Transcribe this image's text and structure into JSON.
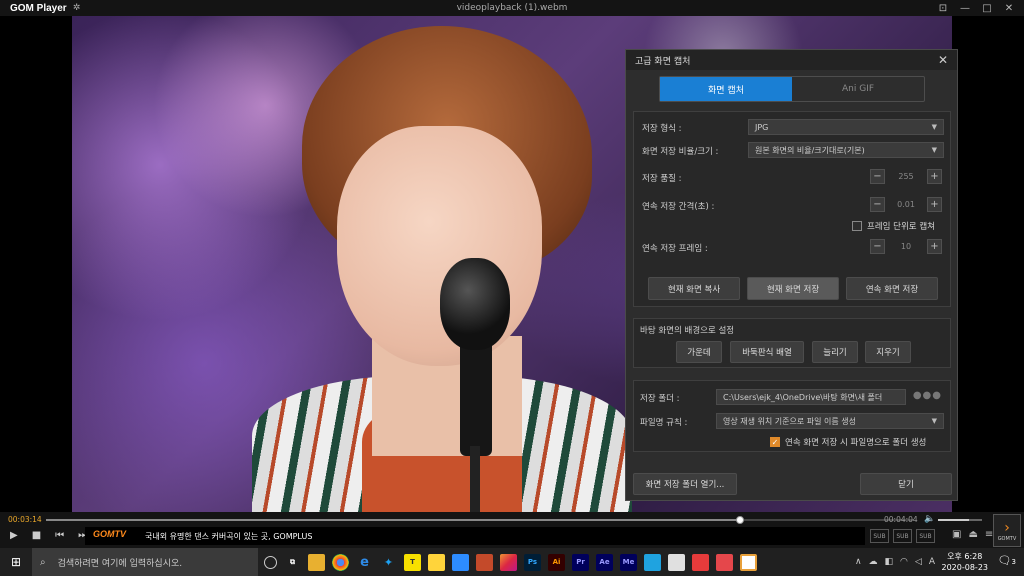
{
  "window": {
    "app_name": "GOM Player",
    "file_title": "videoplayback (1).webm"
  },
  "panel": {
    "title": "고급 화면 캡처",
    "tabs": [
      "화면 캡처",
      "Ani GIF"
    ],
    "fields": {
      "format_label": "저장 형식 :",
      "format_value": "JPG",
      "ratio_label": "화면 저장 비율/크기 :",
      "ratio_value": "원본 화면의 비율/크기대로(기본)",
      "quality_label": "저장 품질 :",
      "quality_value": "255",
      "interval_label": "연속 저장 간격(초) :",
      "interval_value": "0.01",
      "frame_checkbox": "프레임 단위로 캡쳐",
      "frames_label": "연속 저장 프레임 :",
      "frames_value": "10"
    },
    "buttons": {
      "copy": "현재 화면 복사",
      "save": "현재 화면 저장",
      "continuous": "연속 화면 저장"
    },
    "wallpaper": {
      "title": "바탕 화면의 배경으로 설정",
      "center": "가운데",
      "tile": "바둑판식 배열",
      "stretch": "늘리기",
      "clear": "지우기"
    },
    "folder": {
      "label": "저장 폴더 :",
      "value": "C:\\Users\\ejk_4\\OneDrive\\바탕 화면\\새 폴더",
      "rule_label": "파일명 규칙 :",
      "rule_value": "영상 재생 위치 기준으로 파일 이름 생성",
      "subfolder_checkbox": "연속 화면 저장 시 파일명으로 폴더 생성"
    },
    "footer": {
      "open_folder": "화면 저장 폴더 열기...",
      "close": "닫기"
    }
  },
  "player": {
    "time_current": "00:03:14",
    "time_total": "00:04:04",
    "progress": 0.8,
    "volume": 0.7,
    "ticker_brand": "GOMTV",
    "ticker_text": "국내외 유명한 댄스 커버곡이 있는 곳, GOMPLUS",
    "side_label": "GOMTV",
    "btn_labels": [
      "SUB",
      "SUB",
      "SUB"
    ]
  },
  "taskbar": {
    "search_placeholder": "검색하려면 여기에 입력하십시오.",
    "time": "오후 6:28",
    "date": "2020-08-23",
    "notif_count": "3"
  }
}
